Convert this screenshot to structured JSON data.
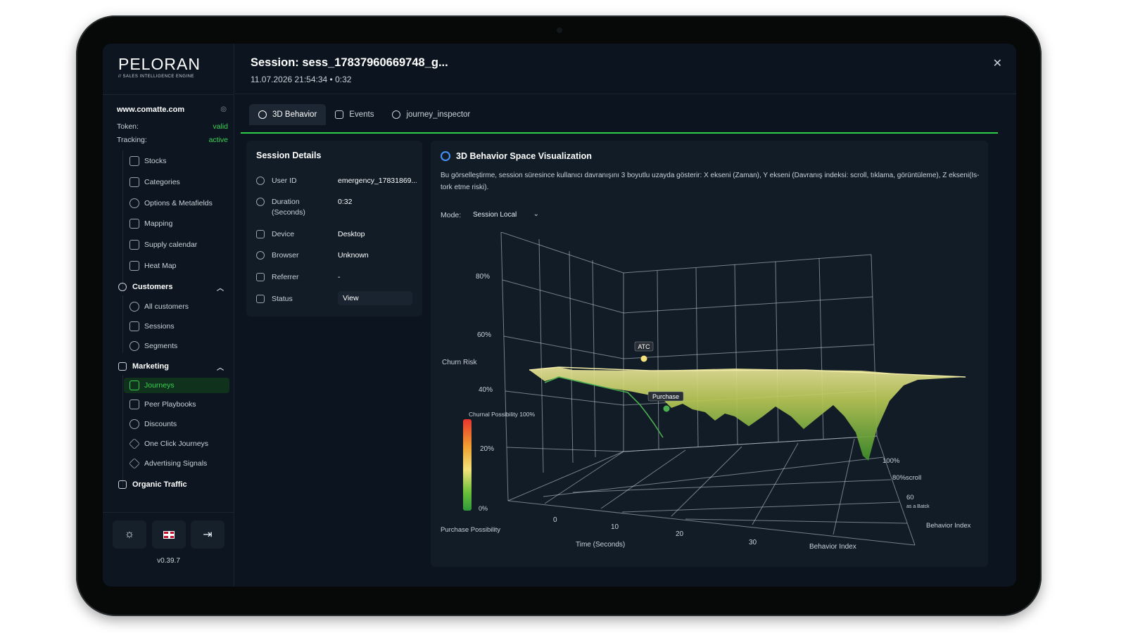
{
  "brand": {
    "name": "PELORAN",
    "tagline": "// SALES INTELLIGENCE ENGINE"
  },
  "site": {
    "domain": "www.comatte.com",
    "token_label": "Token:",
    "token_value": "valid",
    "tracking_label": "Tracking:",
    "tracking_value": "active"
  },
  "sidebar": {
    "catalog_items": [
      {
        "label": "Stocks",
        "icon": "grid-icon"
      },
      {
        "label": "Categories",
        "icon": "grid-icon"
      },
      {
        "label": "Options & Metafields",
        "icon": "gear-icon"
      },
      {
        "label": "Mapping",
        "icon": "map-icon"
      },
      {
        "label": "Supply calendar",
        "icon": "calendar-icon"
      },
      {
        "label": "Heat Map",
        "icon": "heatmap-icon"
      }
    ],
    "customers": {
      "label": "Customers",
      "items": [
        {
          "label": "All customers",
          "icon": "user-icon"
        },
        {
          "label": "Sessions",
          "icon": "cart-icon"
        },
        {
          "label": "Segments",
          "icon": "segment-icon"
        }
      ]
    },
    "marketing": {
      "label": "Marketing",
      "items": [
        {
          "label": "Journeys",
          "icon": "journey-icon",
          "active": true
        },
        {
          "label": "Peer Playbooks",
          "icon": "book-icon"
        },
        {
          "label": "Discounts",
          "icon": "discount-icon"
        },
        {
          "label": "One Click Journeys",
          "icon": "diamond-icon"
        },
        {
          "label": "Advertising Signals",
          "icon": "diamond-icon"
        }
      ]
    },
    "organic": {
      "label": "Organic Traffic"
    },
    "version": "v0.39.7"
  },
  "header": {
    "title": "Session: sess_17837960669748_g...",
    "subtitle": "11.07.2026 21:54:34  •  0:32"
  },
  "tabs": [
    {
      "label": "3D Behavior",
      "active": true
    },
    {
      "label": "Events"
    },
    {
      "label": "journey_inspector"
    }
  ],
  "details": {
    "title": "Session Details",
    "rows": [
      {
        "label": "User ID",
        "value": "emergency_17831869..."
      },
      {
        "label": "Duration (Seconds)",
        "value": "0:32"
      },
      {
        "label": "Device",
        "value": "Desktop"
      },
      {
        "label": "Browser",
        "value": "Unknown"
      },
      {
        "label": "Referrer",
        "value": "-"
      },
      {
        "label": "Status",
        "value": "View"
      }
    ]
  },
  "viz": {
    "title": "3D Behavior Space Visualization",
    "description": "Bu görselleştirme, session süresince kullanıcı davranışını 3 boyutlu uzayda gösterir: X ekseni (Zaman), Y ekseni (Davranış indeksi: scroll, tıklama, görüntüleme), Z ekseni(Is-tork etme riski).",
    "mode_label": "Mode:",
    "mode_value": "Session Local"
  },
  "chart_data": {
    "type": "surface3d",
    "x_axis": {
      "label": "Time (Seconds)",
      "ticks": [
        "0",
        "10",
        "20",
        "30"
      ]
    },
    "y_axis": {
      "label": "Behavior Index",
      "ticks": [
        "100%",
        "80%scroll",
        "60",
        "as a Batck"
      ],
      "end_label": "Behavior Index"
    },
    "z_axis": {
      "label": "Churn Risk",
      "ticks": [
        "80%",
        "60%",
        "40%",
        "20%"
      ]
    },
    "color_scale": {
      "label": "Purchase Possibility",
      "top_label": "Churnal Possibility 100%",
      "bottom_label": "0%",
      "colors": [
        "#e8362e",
        "#f0a030",
        "#f2e27a",
        "#6cc13a",
        "#2e9a3a"
      ]
    },
    "markers": [
      {
        "label": "ATC",
        "time": 11,
        "color": "#f5e27a"
      },
      {
        "label": "Purchase",
        "time": 20,
        "color": "#4caf50"
      }
    ]
  }
}
